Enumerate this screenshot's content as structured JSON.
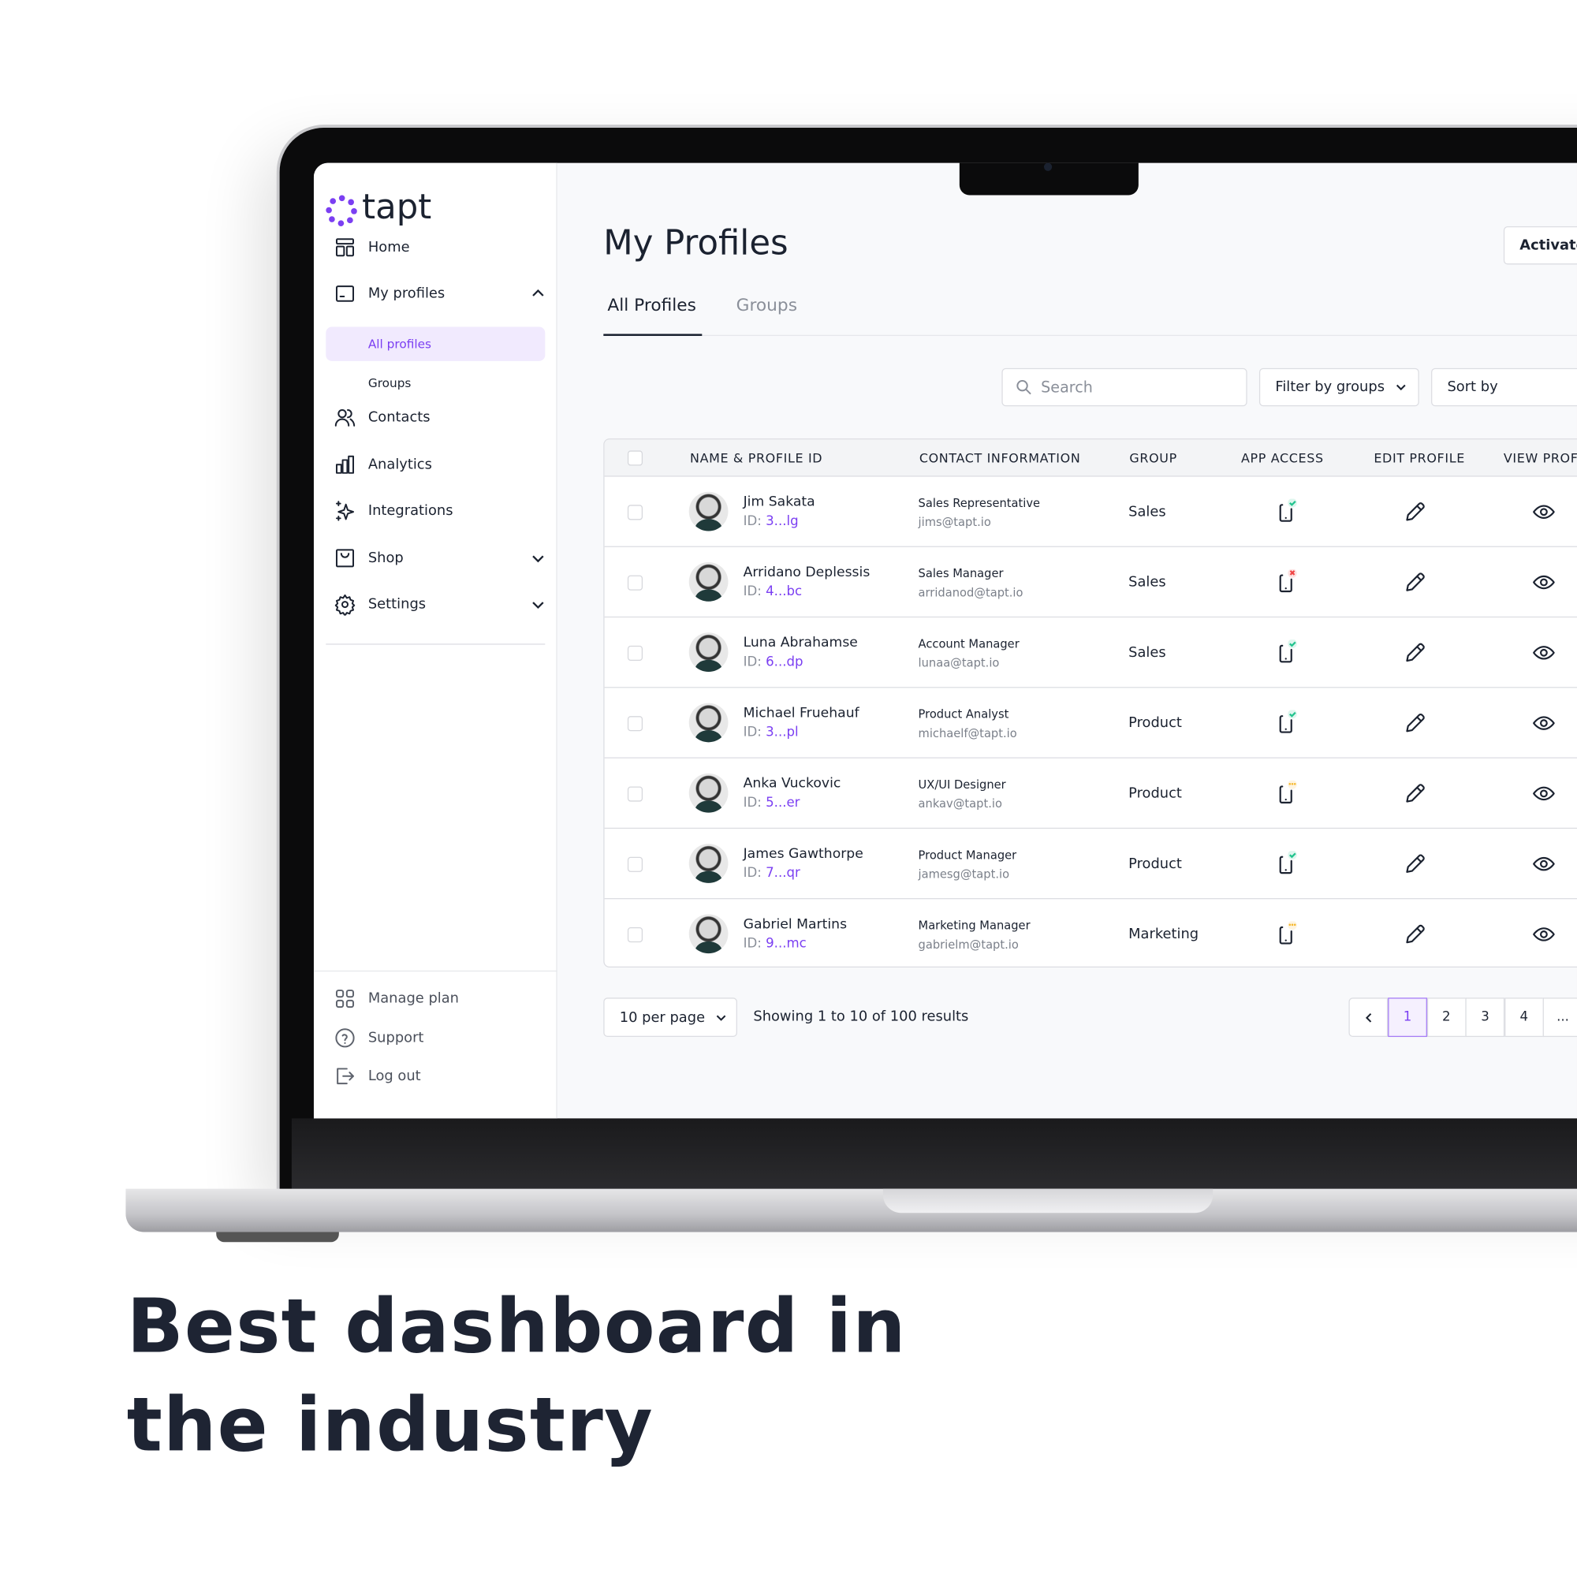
{
  "brand": {
    "name": "tapt",
    "accent": "#7b3ff2"
  },
  "headline": {
    "line1": "Best dashboard in",
    "line2": "the industry"
  },
  "sidebar": {
    "items": [
      {
        "label": "Home",
        "icon": "layout-icon"
      },
      {
        "label": "My profiles",
        "icon": "profile-card-icon"
      },
      {
        "label": "Contacts",
        "icon": "users-icon"
      },
      {
        "label": "Analytics",
        "icon": "bar-chart-icon"
      },
      {
        "label": "Integrations",
        "icon": "sparkle-icon"
      },
      {
        "label": "Shop",
        "icon": "shopping-bag-icon"
      },
      {
        "label": "Settings",
        "icon": "gear-icon"
      }
    ],
    "subitems": [
      {
        "label": "All profiles",
        "active": true
      },
      {
        "label": "Groups",
        "active": false
      }
    ],
    "footer": [
      {
        "label": "Manage plan",
        "icon": "grid-icon"
      },
      {
        "label": "Support",
        "icon": "help-icon"
      },
      {
        "label": "Log out",
        "icon": "logout-icon"
      }
    ]
  },
  "main": {
    "title": "My Profiles",
    "activate_label": "Activate",
    "tabs": [
      {
        "label": "All Profiles",
        "active": true
      },
      {
        "label": "Groups",
        "active": false
      }
    ],
    "search": {
      "placeholder": "Search"
    },
    "filter_label": "Filter by groups",
    "sort_label": "Sort by",
    "table": {
      "headers": [
        "NAME & PROFILE ID",
        "CONTACT INFORMATION",
        "GROUP",
        "APP ACCESS",
        "EDIT PROFILE",
        "VIEW PROFILE"
      ],
      "rows": [
        {
          "name": "Jim Sakata",
          "id_prefix": "ID: ",
          "id": "3...lg",
          "role": "Sales Representative",
          "email": "jims@tapt.io",
          "group": "Sales",
          "access": "granted"
        },
        {
          "name": "Arridano Deplessis",
          "id_prefix": "ID: ",
          "id": "4...bc",
          "role": "Sales Manager",
          "email": "arridanod@tapt.io",
          "group": "Sales",
          "access": "denied"
        },
        {
          "name": "Luna Abrahamse",
          "id_prefix": "ID: ",
          "id": "6...dp",
          "role": "Account Manager",
          "email": "lunaa@tapt.io",
          "group": "Sales",
          "access": "granted"
        },
        {
          "name": "Michael Fruehauf",
          "id_prefix": "ID: ",
          "id": "3...pl",
          "role": "Product Analyst",
          "email": "michaelf@tapt.io",
          "group": "Product",
          "access": "granted"
        },
        {
          "name": "Anka Vuckovic",
          "id_prefix": "ID: ",
          "id": "5...er",
          "role": "UX/UI Designer",
          "email": "ankav@tapt.io",
          "group": "Product",
          "access": "pending"
        },
        {
          "name": "James Gawthorpe",
          "id_prefix": "ID: ",
          "id": "7...qr",
          "role": "Product Manager",
          "email": "jamesg@tapt.io",
          "group": "Product",
          "access": "granted"
        },
        {
          "name": "Gabriel Martins",
          "id_prefix": "ID: ",
          "id": "9...mc",
          "role": "Marketing Manager",
          "email": "gabrielm@tapt.io",
          "group": "Marketing",
          "access": "pending"
        }
      ]
    },
    "per_page": "10 per page",
    "results_text": "Showing 1 to 10 of 100 results",
    "pagination": {
      "pages": [
        "1",
        "2",
        "3",
        "4",
        "..."
      ],
      "current": "1"
    },
    "status_colors": {
      "granted": "#22c38e",
      "denied": "#ef4444",
      "pending": "#f5b82e"
    }
  }
}
